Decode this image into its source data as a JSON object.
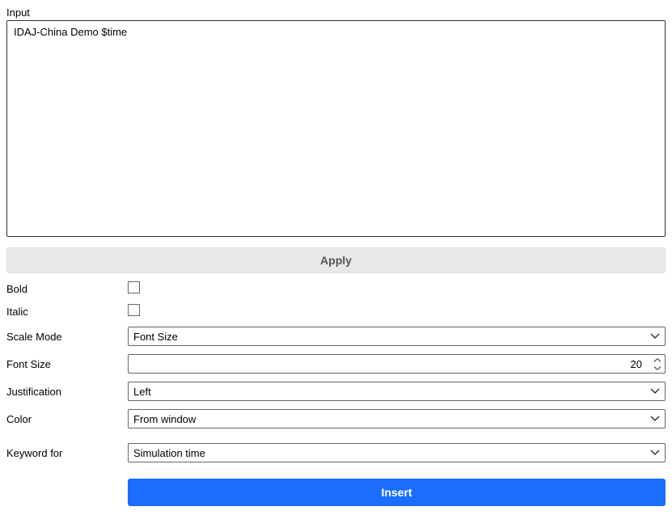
{
  "input": {
    "label": "Input",
    "value": "IDAJ-China Demo $time"
  },
  "apply_button": "Apply",
  "fields": {
    "bold": {
      "label": "Bold",
      "checked": false
    },
    "italic": {
      "label": "Italic",
      "checked": false
    },
    "scale_mode": {
      "label": "Scale Mode",
      "value": "Font Size"
    },
    "font_size": {
      "label": "Font Size",
      "value": "20"
    },
    "justification": {
      "label": "Justification",
      "value": "Left"
    },
    "color": {
      "label": "Color",
      "value": "From window"
    },
    "keyword_for": {
      "label": "Keyword for",
      "value": "Simulation time"
    }
  },
  "insert_button": "Insert"
}
